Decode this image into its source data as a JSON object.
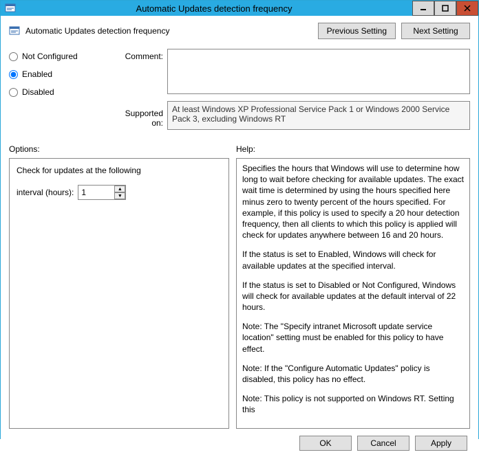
{
  "window": {
    "title": "Automatic Updates detection frequency",
    "minimize": "–",
    "maximize": "▢",
    "close": "✕"
  },
  "header": {
    "policy_title": "Automatic Updates detection frequency",
    "prev_btn": "Previous Setting",
    "next_btn": "Next Setting"
  },
  "state": {
    "not_configured": "Not Configured",
    "enabled": "Enabled",
    "disabled": "Disabled"
  },
  "labels": {
    "comment": "Comment:",
    "supported": "Supported on:",
    "options": "Options:",
    "help": "Help:"
  },
  "fields": {
    "comment_value": "",
    "supported_value": "At least Windows XP Professional Service Pack 1 or Windows 2000 Service Pack 3, excluding Windows RT"
  },
  "options": {
    "check_label": "Check for updates at the following",
    "interval_label": "interval (hours):",
    "interval_value": "1"
  },
  "help": {
    "p1": "Specifies the hours that Windows will use to determine how long to wait before checking for available updates. The exact wait time is determined by using the hours specified here minus zero to twenty percent of the hours specified. For example, if this policy is used to specify a 20 hour detection frequency, then all clients to which this policy is applied will check for updates anywhere between 16 and 20 hours.",
    "p2": "If the status is set to Enabled, Windows will check for available updates at the specified interval.",
    "p3": "If the status is set to Disabled or Not Configured, Windows will check for available updates at the default interval of 22 hours.",
    "p4": "Note: The \"Specify intranet Microsoft update service location\" setting must be enabled for this policy to have effect.",
    "p5": "Note: If the \"Configure Automatic Updates\" policy is disabled, this policy has no effect.",
    "p6": "Note: This policy is not supported on Windows RT. Setting this"
  },
  "footer": {
    "ok": "OK",
    "cancel": "Cancel",
    "apply": "Apply"
  }
}
